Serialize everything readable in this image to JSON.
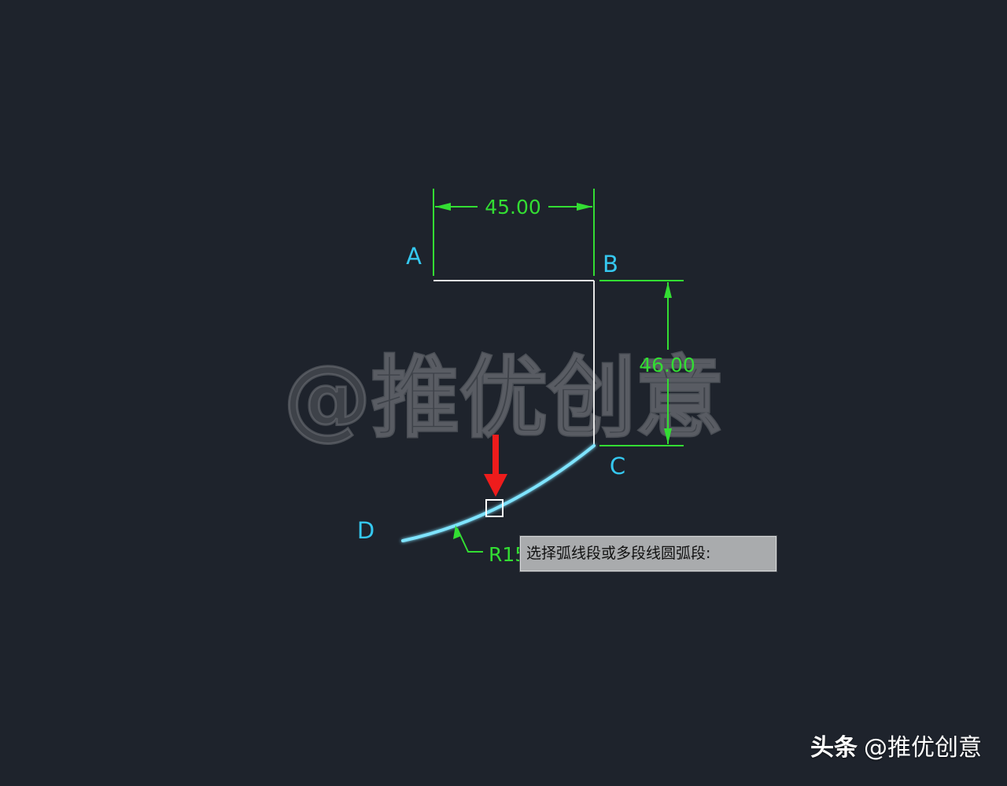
{
  "drawing": {
    "points": {
      "a": "A",
      "b": "B",
      "c": "C",
      "d": "D"
    },
    "dimensions": {
      "horizontal": "45.00",
      "vertical": "46.00",
      "radius_partial": "R15"
    },
    "prompt_tooltip": "选择弧线段或多段线圆弧段:"
  },
  "watermark": {
    "center": "@推优创意",
    "corner_platform": "头条",
    "corner_handle": "@推优创意"
  },
  "colors": {
    "background": "#1e232c",
    "geometry_line": "#e6e6e6",
    "dimension": "#33dd33",
    "point_label": "#35c8f0",
    "selected_arc": "#7fe4ff",
    "pointer_arrow": "#ee1c1c",
    "tooltip_bg": "#a9abad"
  },
  "icons": {
    "pick_box": "pickbox-cursor-icon",
    "pointer": "red-down-arrow-icon"
  }
}
